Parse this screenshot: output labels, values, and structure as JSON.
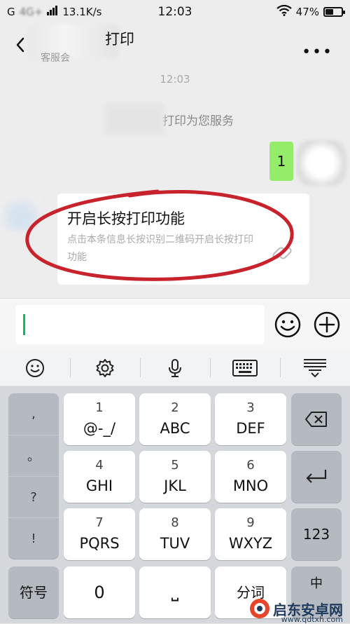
{
  "status_bar": {
    "network": "G",
    "network_type": "4G+",
    "speed": "13.1K/s",
    "time": "12:03",
    "battery_percent": "47%",
    "battery_level": 0.47
  },
  "chat_header": {
    "title": "打印",
    "subtitle": "客服会",
    "more_label": "•••"
  },
  "messages": {
    "timestamp": "12:03",
    "system_text": "打印为您服务",
    "sent_text": "1",
    "card": {
      "title": "开启长按打印功能",
      "description": "点击本条信息长按识别二维码开启长按打印功能"
    }
  },
  "input_bar": {
    "value": "",
    "placeholder": ""
  },
  "keyboard": {
    "punctuation": [
      ",",
      "。",
      "?",
      "!"
    ],
    "keys": [
      {
        "num": "1",
        "letters": "@-_/"
      },
      {
        "num": "2",
        "letters": "ABC"
      },
      {
        "num": "3",
        "letters": "DEF"
      },
      {
        "num": "4",
        "letters": "GHI"
      },
      {
        "num": "5",
        "letters": "JKL"
      },
      {
        "num": "6",
        "letters": "MNO"
      },
      {
        "num": "7",
        "letters": "PQRS"
      },
      {
        "num": "8",
        "letters": "TUV"
      },
      {
        "num": "9",
        "letters": "WXYZ"
      }
    ],
    "numbers_key": "123",
    "symbols_key": "符号",
    "zero_key": "0",
    "space_key": "⎵",
    "segment_key": "分词",
    "lang_key": "中"
  },
  "watermark": {
    "text_cn": "启东安卓网",
    "text_en": "www.qdtxh.com"
  },
  "colors": {
    "sent_bubble": "#95ec69",
    "caret": "#07c160",
    "annotation": "#c8232c"
  }
}
